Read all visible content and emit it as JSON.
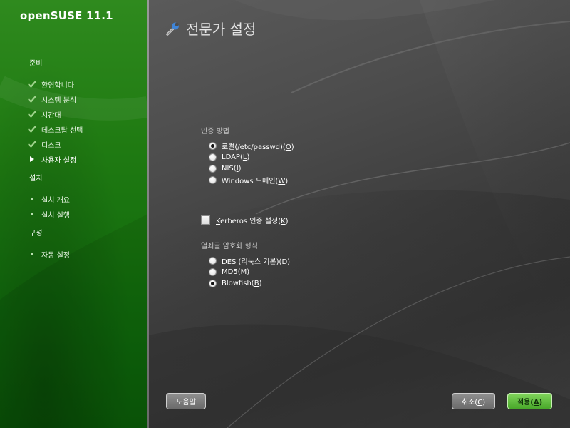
{
  "sidebar": {
    "brand": "openSUSE 11.1",
    "sections": [
      {
        "title": "준비"
      },
      {
        "title": "설치"
      },
      {
        "title": "구성"
      }
    ],
    "prep_steps": [
      {
        "label": "환영합니다",
        "status": "done",
        "icon": "check-icon"
      },
      {
        "label": "시스템 분석",
        "status": "done",
        "icon": "check-icon"
      },
      {
        "label": "시간대",
        "status": "done",
        "icon": "check-icon"
      },
      {
        "label": "데스크탑 선택",
        "status": "done",
        "icon": "check-icon"
      },
      {
        "label": "디스크",
        "status": "done",
        "icon": "check-icon"
      },
      {
        "label": "사용자 설정",
        "status": "current",
        "icon": "arrow-right-icon"
      }
    ],
    "install_steps": [
      {
        "label": "설치 개요",
        "status": "pending",
        "icon": "bullet-icon"
      },
      {
        "label": "설치 실행",
        "status": "pending",
        "icon": "bullet-icon"
      }
    ],
    "config_steps": [
      {
        "label": "자동 설정",
        "status": "pending",
        "icon": "bullet-icon"
      }
    ]
  },
  "main": {
    "title": "전문가 설정",
    "title_icon": "wrench-icon",
    "auth": {
      "label": "인증 방법",
      "options": [
        {
          "text": "로컬(/etc/passwd)(",
          "key": "O",
          "suffix": ")",
          "checked": true
        },
        {
          "text": "LDAP(",
          "key": "L",
          "suffix": ")",
          "checked": false
        },
        {
          "text": "NIS(",
          "key": "I",
          "suffix": ")",
          "checked": false
        },
        {
          "text": "Windows 도메인(",
          "key": "W",
          "suffix": ")",
          "checked": false
        }
      ]
    },
    "kerberos": {
      "prefix": "",
      "key": "K",
      "text": "erberos 인증 설정(",
      "key2": "K",
      "suffix": ")",
      "checked": false
    },
    "encryption": {
      "label": "열쇠글 암호화 형식",
      "options": [
        {
          "text": "DES (리눅스 기본)(",
          "key": "D",
          "suffix": ")",
          "checked": false
        },
        {
          "text": "MD5(",
          "key": "M",
          "suffix": ")",
          "checked": false
        },
        {
          "text": "Blowfish(",
          "key": "B",
          "suffix": ")",
          "checked": true
        }
      ]
    }
  },
  "buttons": {
    "help": "도움말",
    "cancel_text": "취소(",
    "cancel_key": "C",
    "cancel_suffix": ")",
    "accept_text": "적용(",
    "accept_key": "A",
    "accept_suffix": ")"
  },
  "colors": {
    "sidebar_green": "#1f7a12",
    "accept_green": "#5fbf3a",
    "main_gray": "#454545"
  }
}
